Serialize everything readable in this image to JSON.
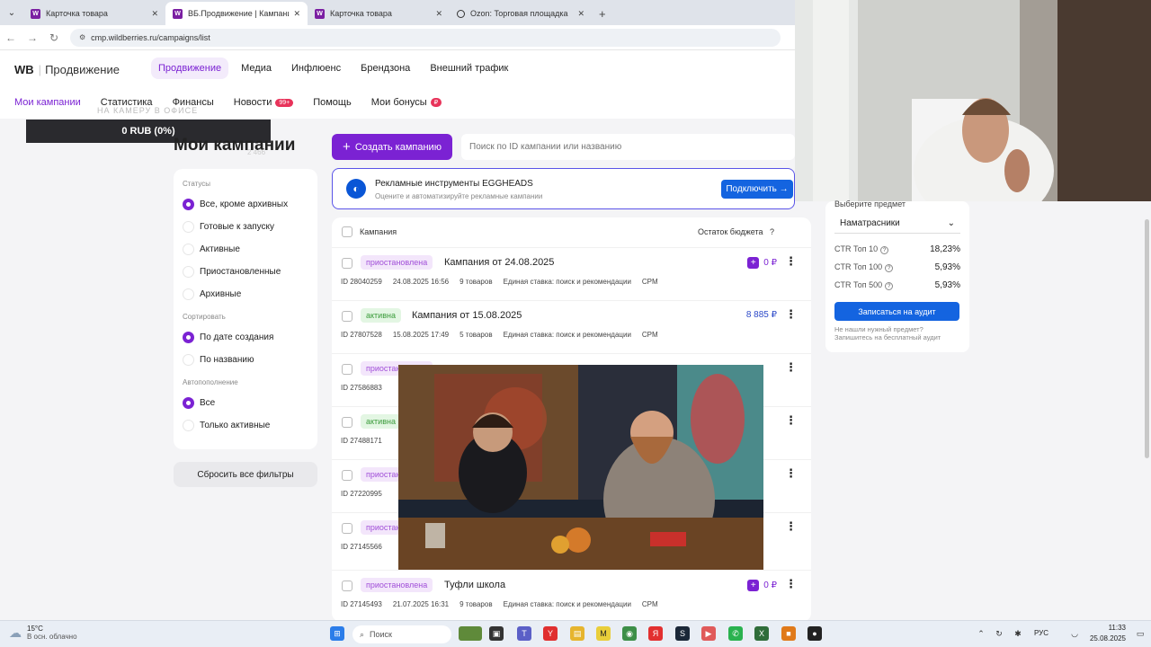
{
  "browser": {
    "tabs": [
      {
        "label": "Карточка товара",
        "icon": "wb-favicon",
        "active": false
      },
      {
        "label": "ВБ.Продвижение | Кампании",
        "icon": "wb-favicon",
        "active": true
      },
      {
        "label": "Карточка товара",
        "icon": "wb-favicon",
        "active": false
      },
      {
        "label": "Ozon: Торговая площадка",
        "icon": "ozon-favicon",
        "active": false
      }
    ],
    "url": "cmp.wildberries.ru/campaigns/list"
  },
  "header": {
    "logo_brand": "WB",
    "logo_product": "Продвижение",
    "top_nav": [
      "Продвижение",
      "Медиа",
      "Инфлюенс",
      "Брендзона",
      "Внешний трафик"
    ],
    "sub_nav": {
      "campaigns": "Мои кампании",
      "stats": "Статистика",
      "finance": "Финансы",
      "news": "Новости",
      "news_badge": "99+",
      "help": "Помощь",
      "bonuses": "Мои бонусы",
      "bonus_badge": "₽"
    },
    "overlay_text": "НА КАМЕРУ В ОФИСЕ"
  },
  "balance_bar": "0 RUB (0%)",
  "page": {
    "title": "Мои кампании",
    "count": "2 466"
  },
  "filters": {
    "statuses_label": "Статусы",
    "statuses": [
      "Все, кроме архивных",
      "Готовые к запуску",
      "Активные",
      "Приостановленные",
      "Архивные"
    ],
    "sort_label": "Сортировать",
    "sort": [
      "По дате создания",
      "По названию"
    ],
    "autorefill_label": "Автопополнение",
    "autorefill": [
      "Все",
      "Только активные"
    ],
    "reset_label": "Сбросить все фильтры"
  },
  "toolbar": {
    "create_label": "Создать кампанию",
    "search_placeholder": "Поиск по ID кампании или названию"
  },
  "banner": {
    "title": "Рекламные инструменты EGGHEADS",
    "subtitle": "Оцените и автоматизируйте рекламные кампании",
    "button": "Подключить →"
  },
  "list": {
    "col_campaign": "Кампания",
    "col_budget": "Остаток бюджета",
    "help_icon": "?",
    "rows": [
      {
        "status": "приостановлена",
        "kind": "paused",
        "name": "Кампания от 24.08.2025",
        "id": "ID 28040259",
        "date": "24.08.2025 16:56",
        "items": "9 товаров",
        "rate": "Единая ставка: поиск и рекомендации",
        "model": "CPM",
        "budget": "0 ₽"
      },
      {
        "status": "активна",
        "kind": "active",
        "name": "Кампания от 15.08.2025",
        "id": "ID 27807528",
        "date": "15.08.2025 17:49",
        "items": "5 товаров",
        "rate": "Единая ставка: поиск и рекомендации",
        "model": "CPM",
        "budget": "8 885 ₽"
      },
      {
        "status": "приостановлена",
        "kind": "paused",
        "name": "",
        "id": "ID 27586883",
        "date": "",
        "items": "",
        "rate": "",
        "model": "",
        "budget": ""
      },
      {
        "status": "активна",
        "kind": "active",
        "name": "",
        "id": "ID 27488171",
        "date": "",
        "items": "",
        "rate": "",
        "model": "",
        "budget": ""
      },
      {
        "status": "приостановлена",
        "kind": "paused",
        "name": "",
        "id": "ID 27220995",
        "date": "",
        "items": "",
        "rate": "",
        "model": "",
        "budget": ""
      },
      {
        "status": "приостановлена",
        "kind": "paused",
        "name": "",
        "id": "ID 27145566",
        "date": "",
        "items": "",
        "rate": "",
        "model": "",
        "budget": ""
      },
      {
        "status": "приостановлена",
        "kind": "paused",
        "name": "Туфли школа",
        "id": "ID 27145493",
        "date": "21.07.2025 16:31",
        "items": "9 товаров",
        "rate": "Единая ставка: поиск и рекомендации",
        "model": "CPM",
        "budget": "0 ₽"
      }
    ]
  },
  "right_panel": {
    "label": "Выберите предмет",
    "select_value": "Наматрасники",
    "ctr": [
      {
        "label": "CTR Топ 10",
        "value": "18,23%"
      },
      {
        "label": "CTR Топ 100",
        "value": "5,93%"
      },
      {
        "label": "CTR Топ 500",
        "value": "5,93%"
      }
    ],
    "audit_button": "Записаться на аудит",
    "note1": "Не нашли нужный предмет?",
    "note2": "Запишитесь на бесплатный аудит"
  },
  "taskbar": {
    "temp": "15°C",
    "weather": "В осн. облачно",
    "search": "Поиск",
    "lang": "РУС",
    "time": "11:33",
    "date": "25.08.2025"
  },
  "colors": {
    "accent": "#7b22d3",
    "blue_button": "#1464e0",
    "paused_bg": "#f3e6fb",
    "active_bg": "#e3f6e3"
  }
}
